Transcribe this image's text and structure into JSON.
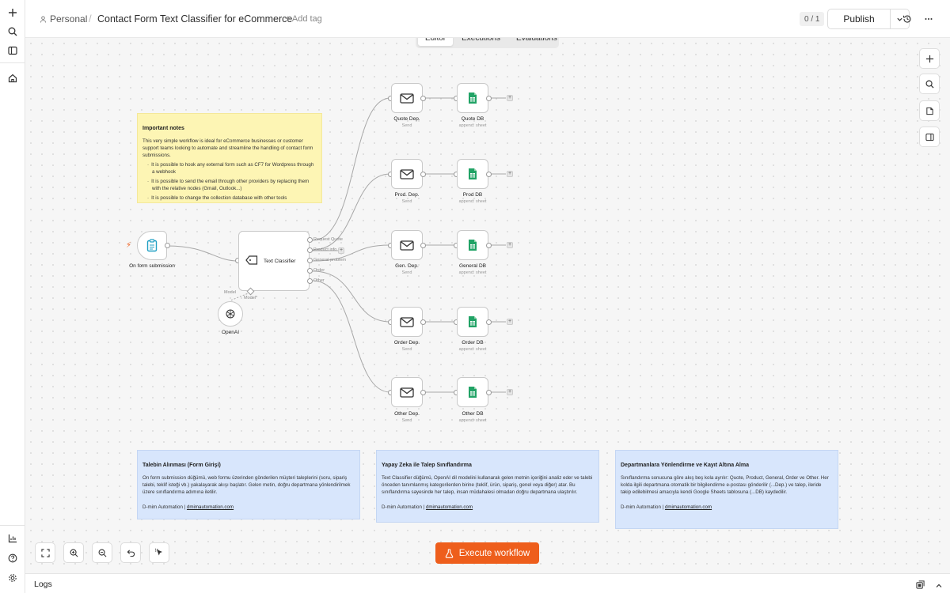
{
  "header": {
    "project": "Personal",
    "separator": "/",
    "title": "Contact Form Text Classifier for eCommerce",
    "add_tag": "+ Add tag",
    "counter": "0 / 1",
    "publish_label": "Publish"
  },
  "tabs": [
    "Editor",
    "Executions",
    "Evaluations"
  ],
  "notes": {
    "important": {
      "title": "Important notes",
      "body": "This very simple workflow is ideal for eCommerce businesses or customer support teams looking to automate and streamline the handling of contact form submissions.",
      "bullets": [
        "It is possible to hook any external form such as CF7 for Wordpress through a webhook",
        "It is possible to send the email through other providers by replacing them with the relative nodes (Gmail, Outlook...)",
        "It is possible to change the collection database with other tools"
      ]
    },
    "step1": {
      "title": "Talebin Alınması (Form Girişi)",
      "body": "On form submission düğümü, web formu üzerinden gönderilen müşteri taleplerini (soru, sipariş talebi, teklif isteği vb.) yakalayarak akışı başlatır. Gelen metin, doğru departmana yönlendirilmek üzere sınıflandırma adımına iletilir.",
      "sig_name": "D-mim Automation",
      "sig_link": "dmimautomation.com"
    },
    "step2": {
      "title": "Yapay Zeka ile Talep Sınıflandırma",
      "body": "Text Classifier düğümü, OpenAI dil modelini kullanarak gelen metnin içeriğini analiz eder ve talebi önceden tanımlanmış kategorilerden birine (teklif, ürün, sipariş, genel veya diğer) atar. Bu sınıflandırma sayesinde her talep, insan müdahalesi olmadan doğru departmana ulaştırılır.",
      "sig_name": "D-mim Automation",
      "sig_link": "dmimautomation.com"
    },
    "step3": {
      "title": "Departmanlara Yönlendirme ve Kayıt Altına Alma",
      "body": "Sınıflandırma sonucuna göre akış beş kola ayrılır: Quote, Product, General, Order ve Other. Her kolda ilgili departmana otomatik bir bilgilendirme e-postası gönderilir (...Dep.) ve talep, ileride takip edilebilmesi amacıyla kendi Google Sheets tablosuna (...DB) kaydedilir.",
      "sig_name": "D-mim Automation",
      "sig_link": "dmimautomation.com"
    }
  },
  "nodes": {
    "trigger": {
      "label": "On form submission"
    },
    "classifier": {
      "label": "Text Classifier",
      "outputs": [
        "Request Quote",
        "Product info",
        "General problem",
        "Order",
        "Other"
      ],
      "model_label": "Model",
      "model_port_label": "Model*"
    },
    "openai": {
      "label": "OpenAI"
    },
    "branches": [
      {
        "mail_label": "Quote Dep.",
        "mail_sub": "Send",
        "sheet_label": "Quote DB",
        "sheet_sub": "append: sheet"
      },
      {
        "mail_label": "Prod. Dep.",
        "mail_sub": "Send",
        "sheet_label": "Prod DB",
        "sheet_sub": "append: sheet"
      },
      {
        "mail_label": "Gen. Dep.",
        "mail_sub": "Send",
        "sheet_label": "General DB",
        "sheet_sub": "append: sheet"
      },
      {
        "mail_label": "Order Dep.",
        "mail_sub": "Send",
        "sheet_label": "Order DB",
        "sheet_sub": "append: sheet"
      },
      {
        "mail_label": "Other Dep.",
        "mail_sub": "Send",
        "sheet_label": "Other DB",
        "sheet_sub": "append: sheet"
      }
    ]
  },
  "execute_label": "Execute workflow",
  "logs_label": "Logs",
  "colors": {
    "accent": "#ee5e1c",
    "sheets": "#21a366",
    "trigger_icon": "#21a0c4"
  }
}
